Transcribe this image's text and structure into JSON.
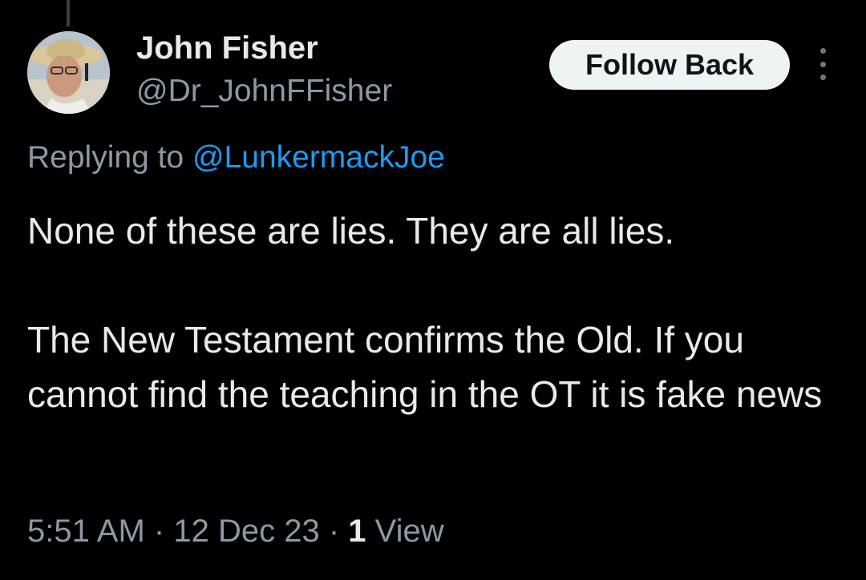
{
  "user": {
    "display_name": "John Fisher",
    "handle": "@Dr_JohnFFisher"
  },
  "actions": {
    "follow_label": "Follow Back",
    "more_icon": "more-vertical-icon"
  },
  "reply": {
    "prefix": "Replying to",
    "mention": "@LunkermackJoe"
  },
  "tweet": {
    "paragraph_1": "None of these are lies. They are all lies.",
    "paragraph_2": "The New Testament confirms the Old. If you cannot find the teaching in the OT it is fake news"
  },
  "meta": {
    "time": "5:51 AM",
    "separator": "·",
    "date": "12 Dec 23",
    "views_count": "1",
    "views_label": "View"
  },
  "colors": {
    "background": "#000000",
    "text_primary": "#e7e9ea",
    "text_secondary": "#8b98a5",
    "link": "#1d9bf0",
    "button_bg": "#eff3f4",
    "button_text": "#0f1419"
  }
}
